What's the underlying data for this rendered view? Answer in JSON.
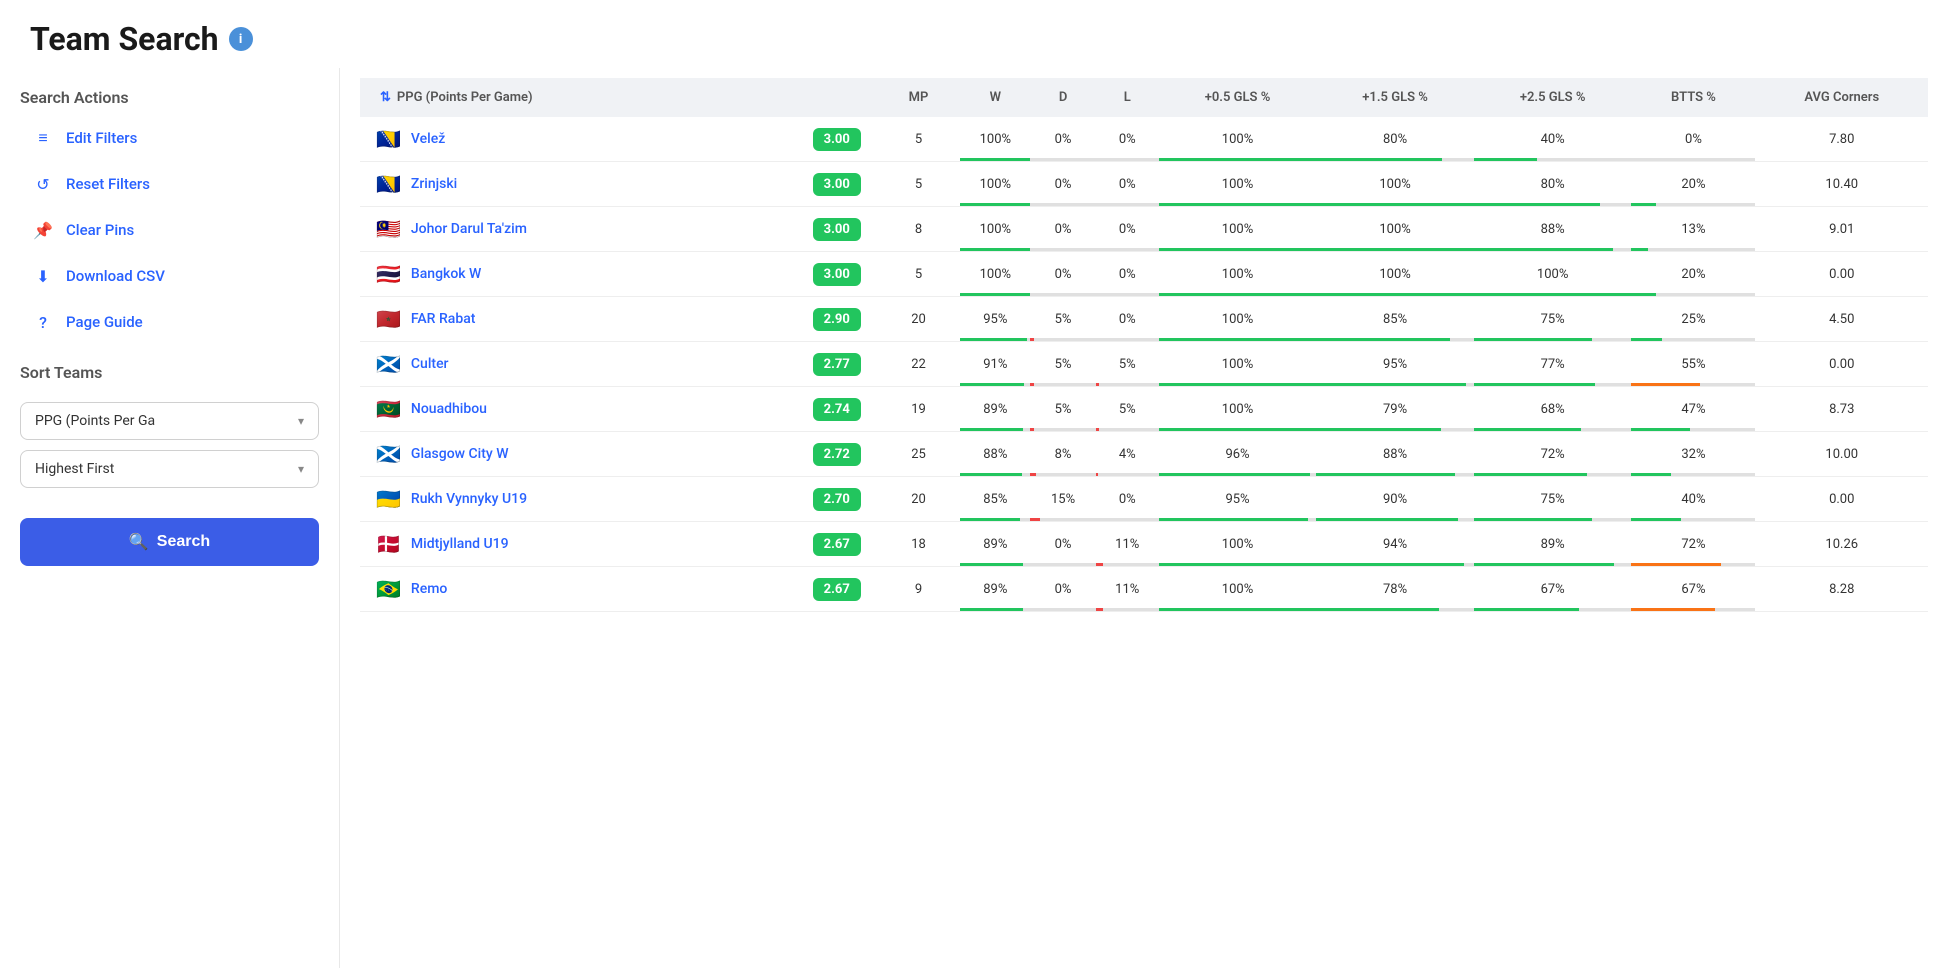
{
  "header": {
    "title": "Team Search",
    "info_icon": "i"
  },
  "sidebar": {
    "search_actions_title": "Search Actions",
    "actions": [
      {
        "id": "edit-filters",
        "label": "Edit Filters",
        "icon": "⚙"
      },
      {
        "id": "reset-filters",
        "label": "Reset Filters",
        "icon": "↺"
      },
      {
        "id": "clear-pins",
        "label": "Clear Pins",
        "icon": "📌"
      },
      {
        "id": "download-csv",
        "label": "Download CSV",
        "icon": "⬇"
      },
      {
        "id": "page-guide",
        "label": "Page Guide",
        "icon": "?"
      }
    ],
    "sort_teams_title": "Sort Teams",
    "sort_field": "PPG (Points Per Ga",
    "sort_order": "Highest First",
    "search_button_label": "Search"
  },
  "table": {
    "sort_column_label": "PPG (Points Per Game)",
    "columns": [
      "MP",
      "W",
      "D",
      "L",
      "+0.5 GLS %",
      "+1.5 GLS %",
      "+2.5 GLS %",
      "BTTS %",
      "AVG Corners"
    ],
    "rows": [
      {
        "flag": "🇧🇦",
        "name": "Velež",
        "ppg": "3.00",
        "ppg_color": "green",
        "mp": 5,
        "w": "100%",
        "d": "0%",
        "l": "0%",
        "g05": "100%",
        "g15": "80%",
        "g25": "40%",
        "btts": "0%",
        "avg_corners": "7.80"
      },
      {
        "flag": "🇧🇦",
        "name": "Zrinjski",
        "ppg": "3.00",
        "ppg_color": "green",
        "mp": 5,
        "w": "100%",
        "d": "0%",
        "l": "0%",
        "g05": "100%",
        "g15": "100%",
        "g25": "80%",
        "btts": "20%",
        "avg_corners": "10.40"
      },
      {
        "flag": "🇲🇾",
        "name": "Johor Darul Ta'zim",
        "ppg": "3.00",
        "ppg_color": "green",
        "mp": 8,
        "w": "100%",
        "d": "0%",
        "l": "0%",
        "g05": "100%",
        "g15": "100%",
        "g25": "88%",
        "btts": "13%",
        "avg_corners": "9.01"
      },
      {
        "flag": "🇹🇭",
        "name": "Bangkok W",
        "ppg": "3.00",
        "ppg_color": "green",
        "mp": 5,
        "w": "100%",
        "d": "0%",
        "l": "0%",
        "g05": "100%",
        "g15": "100%",
        "g25": "100%",
        "btts": "20%",
        "avg_corners": "0.00"
      },
      {
        "flag": "🇲🇦",
        "name": "FAR Rabat",
        "ppg": "2.90",
        "ppg_color": "green",
        "mp": 20,
        "w": "95%",
        "d": "5%",
        "l": "0%",
        "g05": "100%",
        "g15": "85%",
        "g25": "75%",
        "btts": "25%",
        "avg_corners": "4.50"
      },
      {
        "flag": "🏴󠁧󠁢󠁳󠁣󠁴󠁿",
        "name": "Culter",
        "ppg": "2.77",
        "ppg_color": "green",
        "mp": 22,
        "w": "91%",
        "d": "5%",
        "l": "5%",
        "g05": "100%",
        "g15": "95%",
        "g25": "77%",
        "btts": "55%",
        "avg_corners": "0.00"
      },
      {
        "flag": "🇲🇷",
        "name": "Nouadhibou",
        "ppg": "2.74",
        "ppg_color": "green",
        "mp": 19,
        "w": "89%",
        "d": "5%",
        "l": "5%",
        "g05": "100%",
        "g15": "79%",
        "g25": "68%",
        "btts": "47%",
        "avg_corners": "8.73"
      },
      {
        "flag": "🏴󠁧󠁢󠁳󠁣󠁴󠁿",
        "name": "Glasgow City W",
        "ppg": "2.72",
        "ppg_color": "green",
        "mp": 25,
        "w": "88%",
        "d": "8%",
        "l": "4%",
        "g05": "96%",
        "g15": "88%",
        "g25": "72%",
        "btts": "32%",
        "avg_corners": "10.00"
      },
      {
        "flag": "🇺🇦",
        "name": "Rukh Vynnyky U19",
        "ppg": "2.70",
        "ppg_color": "green",
        "mp": 20,
        "w": "85%",
        "d": "15%",
        "l": "0%",
        "g05": "95%",
        "g15": "90%",
        "g25": "75%",
        "btts": "40%",
        "avg_corners": "0.00"
      },
      {
        "flag": "🇩🇰",
        "name": "Midtjylland U19",
        "ppg": "2.67",
        "ppg_color": "green",
        "mp": 18,
        "w": "89%",
        "d": "0%",
        "l": "11%",
        "g05": "100%",
        "g15": "94%",
        "g25": "89%",
        "btts": "72%",
        "avg_corners": "10.26"
      },
      {
        "flag": "🇧🇷",
        "name": "Remo",
        "ppg": "2.67",
        "ppg_color": "green",
        "mp": 9,
        "w": "89%",
        "d": "0%",
        "l": "11%",
        "g05": "100%",
        "g15": "78%",
        "g25": "67%",
        "btts": "67%",
        "avg_corners": "8.28"
      }
    ]
  }
}
